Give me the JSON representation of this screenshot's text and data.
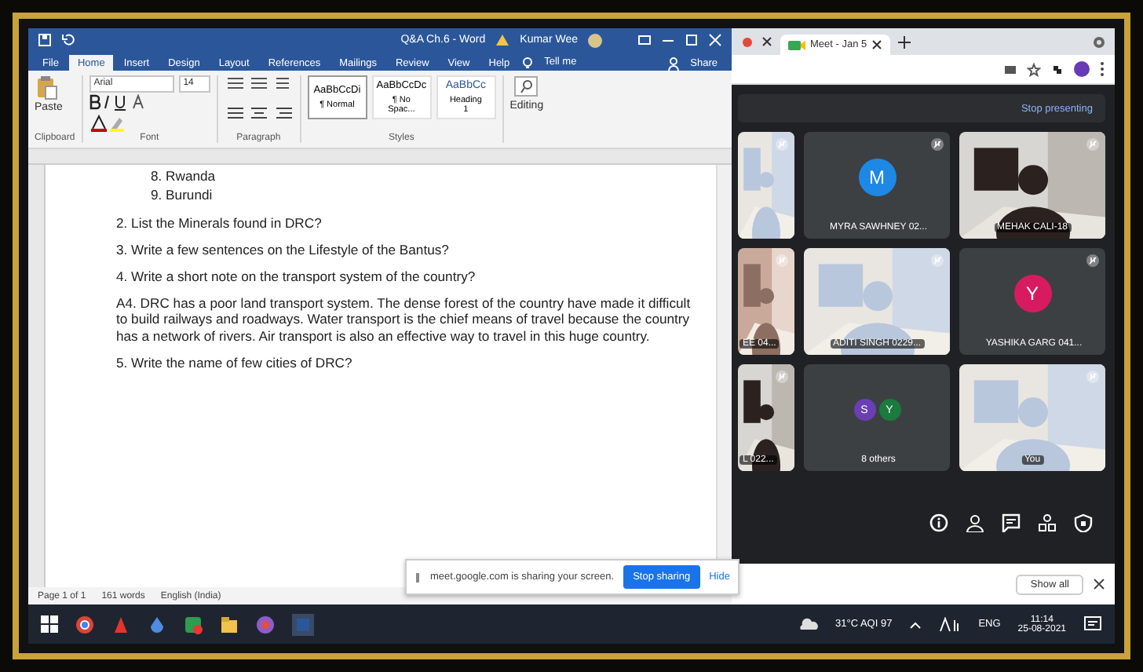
{
  "word": {
    "title": "Q&A Ch.6 - Word",
    "user": "Kumar Wee",
    "menu_tabs": [
      {
        "label": "File",
        "selected": false
      },
      {
        "label": "Home",
        "selected": true
      },
      {
        "label": "Insert",
        "selected": false
      },
      {
        "label": "Design",
        "selected": false
      },
      {
        "label": "Layout",
        "selected": false
      },
      {
        "label": "References",
        "selected": false
      },
      {
        "label": "Mailings",
        "selected": false
      },
      {
        "label": "Review",
        "selected": false
      },
      {
        "label": "View",
        "selected": false
      },
      {
        "label": "Help",
        "selected": false
      }
    ],
    "tell_me": "Tell me",
    "share": "Share",
    "ribbon": {
      "paste": "Paste",
      "font_name": "Arial",
      "font_size": "14",
      "editing": "Editing",
      "groups": [
        "Clipboard",
        "Font",
        "Paragraph",
        "Styles"
      ],
      "styles": [
        {
          "sample": "AaBbCcDi",
          "name": "¶ Normal",
          "selected": true
        },
        {
          "sample": "AaBbCcDc",
          "name": "¶ No Spac...",
          "selected": false
        },
        {
          "sample": "AaBbCc",
          "name": "Heading 1",
          "selected": false
        }
      ]
    },
    "document": {
      "list_items": [
        "8. Rwanda",
        "9. Burundi"
      ],
      "paragraphs": [
        "2. List the Minerals found in DRC?",
        "3. Write a few sentences on the Lifestyle of the Bantus?",
        "4. Write a short note on the transport system of the country?",
        "A4. DRC has a poor land transport system. The dense forest of the country have made it difficult to build railways and roadways. Water transport is the chief means of travel because the country has a network of rivers. Air transport is also an effective way to travel in this huge country.",
        "5. Write the name of few cities of DRC?"
      ]
    },
    "status_bar": {
      "page": "Page 1 of 1",
      "words": "161 words",
      "language": "English (India)"
    }
  },
  "browser": {
    "tab": "Meet - Jan 5",
    "stop_presenting": "Stop presenting",
    "tiles": [
      {
        "kind": "picture"
      },
      {
        "kind": "avatar",
        "initial": "M",
        "color": "#1e88e5",
        "name": "MYRA SAWHNEY 02..."
      },
      {
        "kind": "picture",
        "name": "MEHAK CALI-18"
      },
      {
        "kind": "picture",
        "name": "EE 04..."
      },
      {
        "kind": "picture",
        "name": "ADITI SINGH 0229..."
      },
      {
        "kind": "avatar",
        "initial": "Y",
        "color": "#d81b60",
        "name": "YASHIKA GARG 041..."
      },
      {
        "kind": "picture",
        "name": "L 022..."
      },
      {
        "kind": "others",
        "initials": [
          {
            "letter": "S",
            "color": "#6a3fb5"
          },
          {
            "letter": "Y",
            "color": "#1b7a3e"
          }
        ],
        "name": "8 others"
      },
      {
        "kind": "picture",
        "name": "You"
      }
    ],
    "show_all": "Show all"
  },
  "share_notice": {
    "message": "meet.google.com is sharing your screen.",
    "stop": "Stop sharing",
    "hide": "Hide"
  },
  "taskbar": {
    "weather": "31°C AQI 97",
    "language": "ENG",
    "time": "11:14",
    "date": "25-08-2021"
  }
}
